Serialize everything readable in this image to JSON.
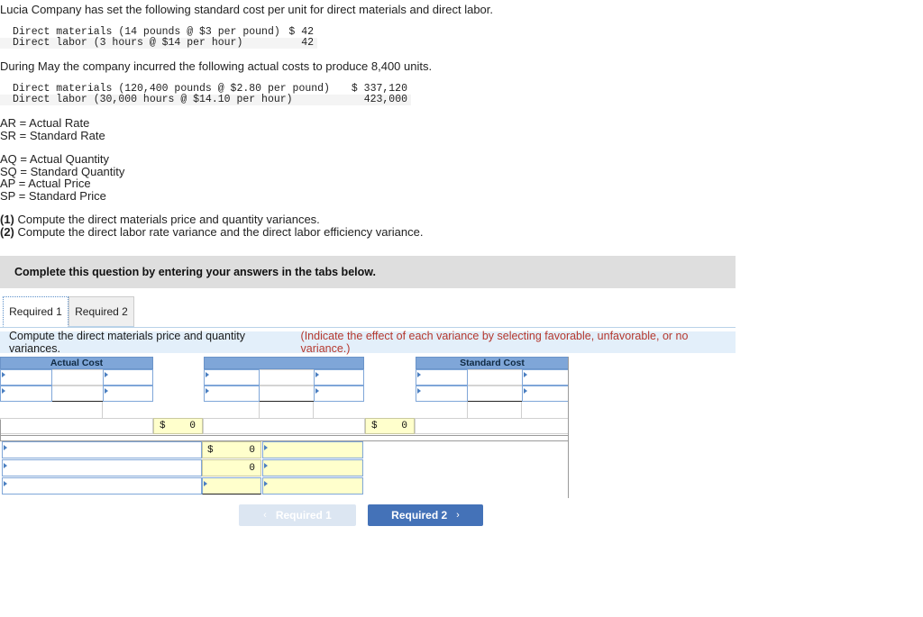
{
  "intro": {
    "line1": "Lucia Company has set the following standard cost per unit for direct materials and direct labor.",
    "line2": "During May the company incurred the following actual costs to produce 8,400 units."
  },
  "standard_cost_table": {
    "rows": [
      {
        "label": "Direct materials (14 pounds @ $3 per pound)",
        "amount": "$ 42"
      },
      {
        "label": "Direct labor (3 hours @ $14 per hour)",
        "amount": "42"
      }
    ]
  },
  "actual_cost_table": {
    "rows": [
      {
        "label": "Direct materials (120,400 pounds @ $2.80 per pound)",
        "amount": "$ 337,120"
      },
      {
        "label": "Direct labor (30,000 hours @ $14.10 per hour)",
        "amount": "423,000"
      }
    ]
  },
  "legend": {
    "rate_lines": [
      "AR = Actual Rate",
      "SR = Standard Rate"
    ],
    "quantity_lines": [
      "AQ = Actual Quantity",
      "SQ = Standard Quantity",
      "AP = Actual Price",
      "SP = Standard Price"
    ]
  },
  "requirements": [
    {
      "number": "(1)",
      "text": "Compute the direct materials price and quantity variances."
    },
    {
      "number": "(2)",
      "text": "Compute the direct labor rate variance and the direct labor efficiency variance."
    }
  ],
  "banner": {
    "text": "Complete this question by entering your answers in the tabs below."
  },
  "tabs": [
    {
      "label": "Required 1",
      "active": true
    },
    {
      "label": "Required 2",
      "active": false
    }
  ],
  "sub_instruction": {
    "main": "Compute the direct materials price and quantity variances.",
    "hint": "(Indicate the effect of each variance by selecting favorable, unfavorable, or no variance.)",
    "hint_color": "#b5392f"
  },
  "worksheet_top": {
    "panels": [
      {
        "header": "Actual Cost",
        "row1": [
          "",
          "",
          ""
        ],
        "row2": [
          "",
          "",
          ""
        ],
        "row3": [
          "",
          "",
          ""
        ]
      },
      {
        "header": "",
        "row1": [
          "",
          "",
          ""
        ],
        "row2": [
          "",
          "",
          ""
        ],
        "row3": [
          "",
          "",
          ""
        ]
      },
      {
        "header": "Standard Cost",
        "row1": [
          "",
          "",
          ""
        ],
        "row2": [
          "",
          "",
          ""
        ],
        "row3": [
          "",
          "",
          ""
        ]
      }
    ],
    "totals": [
      {
        "currency": "$",
        "value": "0"
      },
      {
        "currency": "$",
        "value": "0"
      }
    ]
  },
  "worksheet_bottom": {
    "rows": [
      {
        "name": "",
        "currency": "$",
        "value": "0",
        "effect": ""
      },
      {
        "name": "",
        "currency": "",
        "value": "0",
        "effect": ""
      },
      {
        "name": "",
        "currency": "",
        "value": "",
        "effect": ""
      }
    ]
  },
  "nav": {
    "prev": {
      "label": "Required 1",
      "chevron": "‹",
      "enabled": false
    },
    "next": {
      "label": "Required 2",
      "chevron": "›",
      "enabled": true
    }
  },
  "colors": {
    "header_blue": "#7fa6d8",
    "input_yellow": "#ffffcc",
    "banner_gray": "#dedede",
    "instruction_blue": "#e3effa",
    "accent_button": "#4472b8",
    "hint_red": "#b5392f"
  }
}
